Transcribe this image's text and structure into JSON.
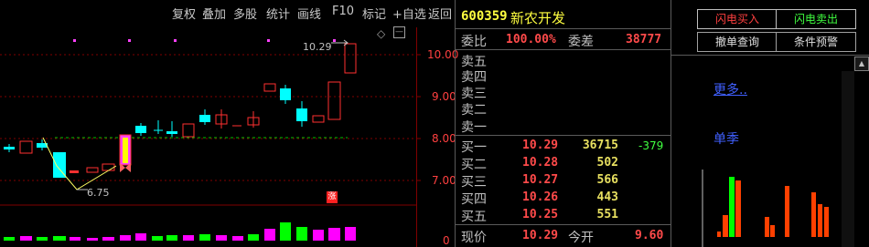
{
  "toolbar": {
    "buttons": [
      "复权",
      "叠加",
      "多股",
      "统计",
      "画线",
      "F10",
      "标记",
      "+自选",
      "返回"
    ],
    "arrow_icon": "arrow-out-icon"
  },
  "chart": {
    "price_ticks": [
      "10.00",
      "9.00",
      "8.00",
      "7.00",
      "0"
    ],
    "max_label": "10.29",
    "min_label": "6.75",
    "limit_up_badge": "涨"
  },
  "stock": {
    "code": "600359",
    "name": "新农开发"
  },
  "order_book": {
    "weibi_label": "委比",
    "weibi_value": "100.00%",
    "weicha_label": "委差",
    "weicha_value": "38777",
    "asks": [
      {
        "label": "卖五"
      },
      {
        "label": "卖四"
      },
      {
        "label": "卖三"
      },
      {
        "label": "卖二"
      },
      {
        "label": "卖一"
      }
    ],
    "bids": [
      {
        "label": "买一",
        "price": "10.29",
        "volume": "36715",
        "change": "-379"
      },
      {
        "label": "买二",
        "price": "10.28",
        "volume": "502"
      },
      {
        "label": "买三",
        "price": "10.27",
        "volume": "566"
      },
      {
        "label": "买四",
        "price": "10.26",
        "volume": "443"
      },
      {
        "label": "买五",
        "price": "10.25",
        "volume": "551"
      }
    ],
    "current_label": "现价",
    "current_value": "10.29",
    "open_label": "今开",
    "open_value": "9.60"
  },
  "right_panel": {
    "flash_buy": "闪电买入",
    "flash_sell": "闪电卖出",
    "cancel_query": "撤单查询",
    "condition_alert": "条件预警",
    "more_link": "更多..",
    "single_quarter": "单季"
  },
  "colors": {
    "up": "#ff3030",
    "down": "#00ffff",
    "accent_green": "#00ff00",
    "limit": "#ff0000"
  }
}
